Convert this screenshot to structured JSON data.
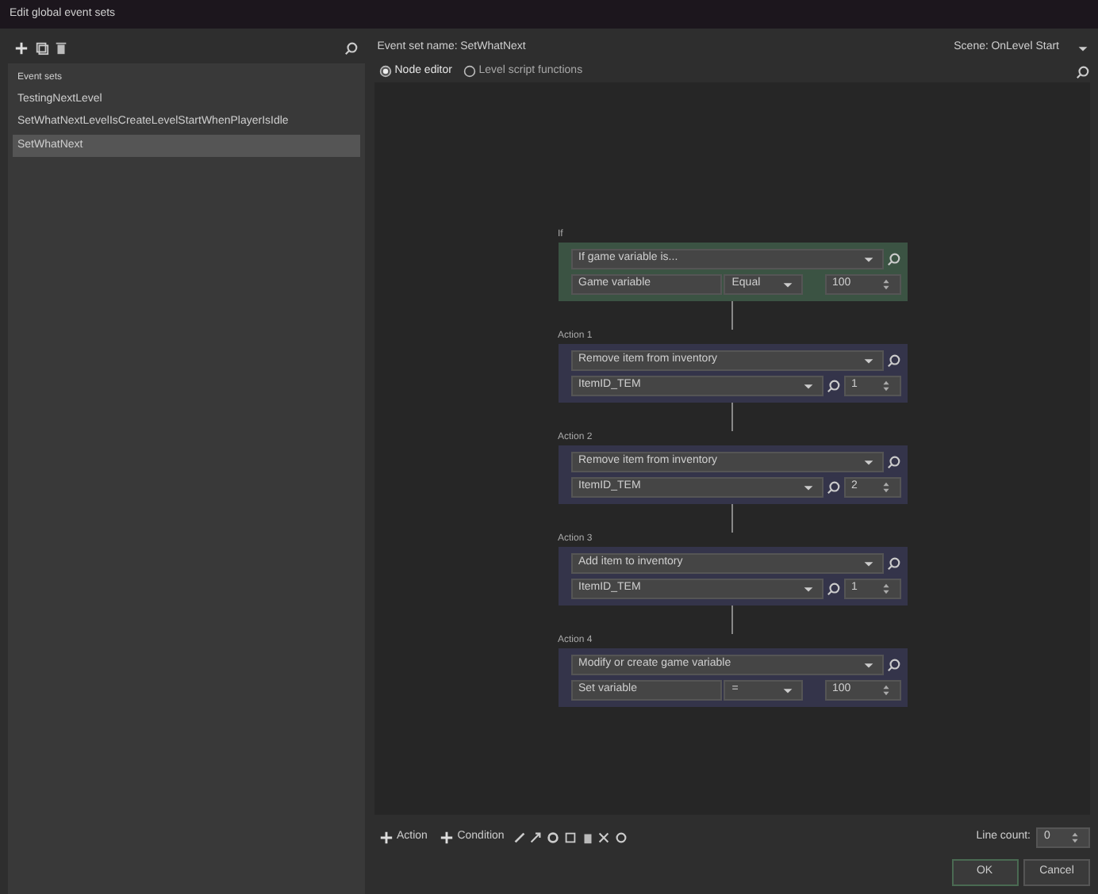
{
  "window": {
    "title": "Edit global event sets"
  },
  "sidebar": {
    "heading": "Event sets",
    "items": [
      {
        "label": "TestingNextLevel",
        "selected": false
      },
      {
        "label": "SetWhatNextLevelIsCreateLevelStartWhenPlayerIsIdle",
        "selected": false
      },
      {
        "label": "SetWhatNext",
        "selected": true
      }
    ]
  },
  "header": {
    "name_label": "Event set name:",
    "name_value": "SetWhatNext",
    "scene_label": "Scene:",
    "scene_value": "OnLevel Start"
  },
  "modes": [
    {
      "label": "Node editor",
      "selected": true
    },
    {
      "label": "Level script functions",
      "selected": false
    }
  ],
  "nodes": [
    {
      "kind": "condition",
      "label": "If",
      "selector": "If game variable is...",
      "fields": [
        {
          "kind": "text",
          "value": "Game variable"
        },
        {
          "kind": "select",
          "value": "Equal"
        },
        {
          "kind": "number",
          "value": "100"
        }
      ]
    },
    {
      "kind": "action",
      "label": "Action 1",
      "selector": "Remove item from inventory",
      "fields": [
        {
          "kind": "search",
          "value": "ItemID_TEM"
        },
        {
          "kind": "number",
          "value": "1"
        }
      ]
    },
    {
      "kind": "action",
      "label": "Action 2",
      "selector": "Remove item from inventory",
      "fields": [
        {
          "kind": "search",
          "value": "ItemID_TEM"
        },
        {
          "kind": "number",
          "value": "2"
        }
      ]
    },
    {
      "kind": "action",
      "label": "Action 3",
      "selector": "Add item to inventory",
      "fields": [
        {
          "kind": "search",
          "value": "ItemID_TEM"
        },
        {
          "kind": "number",
          "value": "1"
        }
      ]
    },
    {
      "kind": "action",
      "label": "Action 4",
      "selector": "Modify or create game variable",
      "fields": [
        {
          "kind": "text",
          "value": "Set variable"
        },
        {
          "kind": "select",
          "value": "="
        },
        {
          "kind": "number",
          "value": "100"
        }
      ]
    }
  ],
  "toolbar": {
    "add_action": "Action",
    "add_condition": "Condition",
    "line_count_label": "Line count:",
    "line_count_value": "0"
  },
  "buttons": [
    {
      "label": "OK",
      "kind": "primary"
    },
    {
      "label": "Cancel",
      "kind": "secondary"
    }
  ]
}
